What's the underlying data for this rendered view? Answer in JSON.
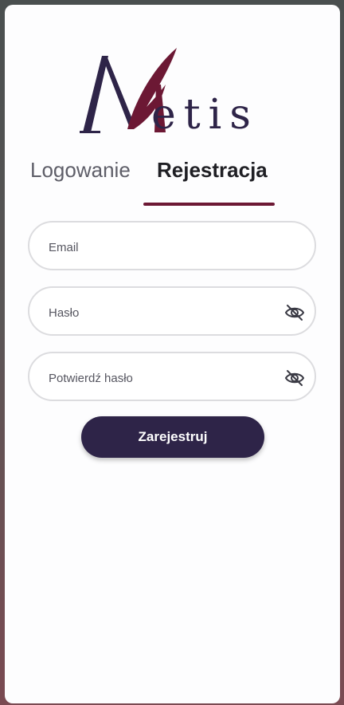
{
  "app": {
    "name": "Metis",
    "logo_initial": "M",
    "logo_rest": "etis"
  },
  "tabs": [
    {
      "label": "Logowanie",
      "active": false
    },
    {
      "label": "Rejestracja",
      "active": true
    }
  ],
  "form": {
    "email_placeholder": "Email",
    "password_placeholder": "Hasło",
    "confirm_placeholder": "Potwierdź hasło",
    "submit_label": "Zarejestruj"
  },
  "colors": {
    "brand_dark": "#2e2448",
    "brand_accent": "#6c1834"
  },
  "icons": {
    "password_toggle": "eye-off-icon"
  }
}
